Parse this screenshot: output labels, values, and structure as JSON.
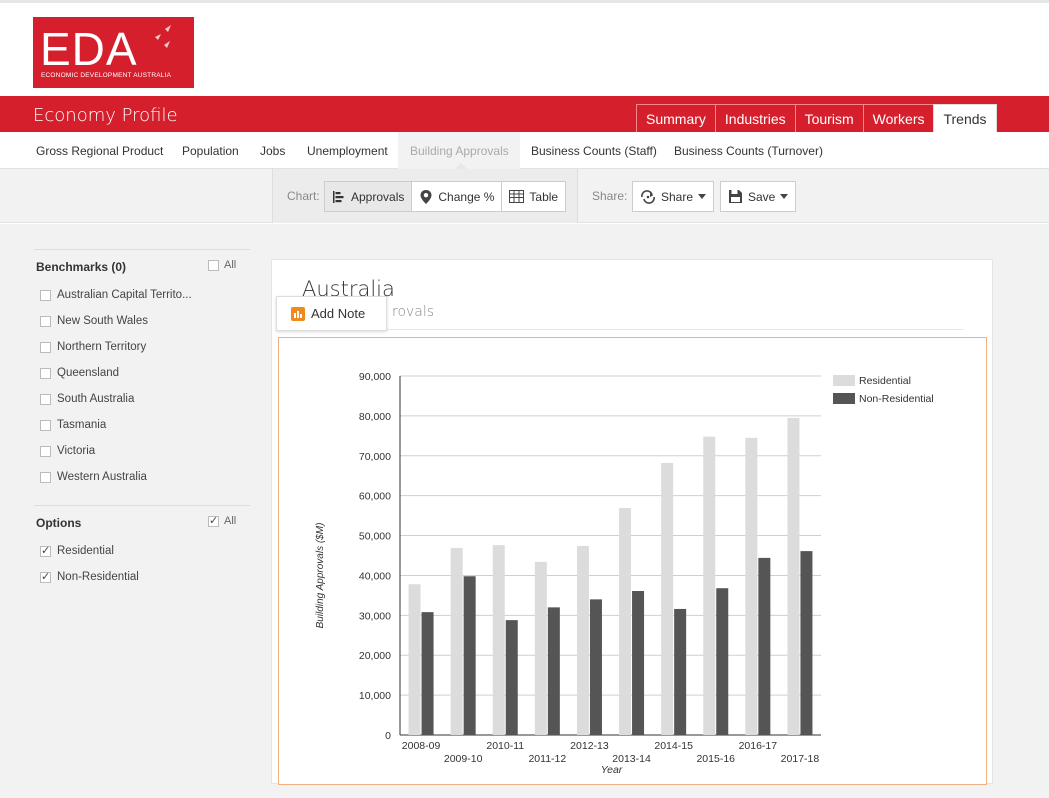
{
  "logo": {
    "text": "EDA",
    "subtitle": "ECONOMIC DEVELOPMENT AUSTRALIA"
  },
  "header": {
    "app_title": "Economy Profile",
    "tabs": [
      {
        "label": "Summary",
        "active": false
      },
      {
        "label": "Industries",
        "active": false
      },
      {
        "label": "Tourism",
        "active": false
      },
      {
        "label": "Workers",
        "active": false
      },
      {
        "label": "Trends",
        "active": true
      }
    ]
  },
  "subnav": {
    "items": [
      {
        "label": "Gross Regional Product"
      },
      {
        "label": "Population"
      },
      {
        "label": "Jobs"
      },
      {
        "label": "Unemployment"
      },
      {
        "label": "Building Approvals",
        "active": true
      },
      {
        "label": "Business Counts (Staff)"
      },
      {
        "label": "Business Counts (Turnover)"
      }
    ]
  },
  "toolbar": {
    "chart_label": "Chart:",
    "chart_buttons": [
      {
        "label": "Approvals",
        "icon": "bar-chart-icon",
        "active": true
      },
      {
        "label": "Change %",
        "icon": "map-pin-icon",
        "active": false
      },
      {
        "label": "Table",
        "icon": "table-icon",
        "active": false
      }
    ],
    "share_label": "Share:",
    "share_button": "Share",
    "save_button": "Save"
  },
  "sidebar": {
    "benchmarks_heading": "Benchmarks (0)",
    "benchmarks_all": "All",
    "benchmarks": [
      {
        "label": "Australian Capital Territo...",
        "checked": false
      },
      {
        "label": "New South Wales",
        "checked": false
      },
      {
        "label": "Northern Territory",
        "checked": false
      },
      {
        "label": "Queensland",
        "checked": false
      },
      {
        "label": "South Australia",
        "checked": false
      },
      {
        "label": "Tasmania",
        "checked": false
      },
      {
        "label": "Victoria",
        "checked": false
      },
      {
        "label": "Western Australia",
        "checked": false
      }
    ],
    "options_heading": "Options",
    "options_all": "All",
    "options": [
      {
        "label": "Residential",
        "checked": true
      },
      {
        "label": "Non-Residential",
        "checked": true
      }
    ]
  },
  "card": {
    "title": "Australia",
    "subtitle": "rovals",
    "add_note": "Add Note"
  },
  "chart_data": {
    "type": "bar",
    "categories": [
      "2008-09",
      "2009-10",
      "2010-11",
      "2011-12",
      "2012-13",
      "2013-14",
      "2014-15",
      "2015-16",
      "2016-17",
      "2017-18"
    ],
    "series": [
      {
        "name": "Residential",
        "color": "#dcdcdc",
        "values": [
          37800,
          46900,
          47600,
          43400,
          47400,
          56900,
          68200,
          74800,
          74500,
          79500
        ]
      },
      {
        "name": "Non-Residential",
        "color": "#555555",
        "values": [
          30800,
          39800,
          28800,
          32000,
          34000,
          36100,
          31600,
          36800,
          44400,
          46100
        ]
      }
    ],
    "xlabel": "Year",
    "ylabel": "Building Approvals ($M)",
    "ylim": [
      0,
      90000
    ],
    "yticks": [
      "0",
      "10,000",
      "20,000",
      "30,000",
      "40,000",
      "50,000",
      "60,000",
      "70,000",
      "80,000",
      "90,000"
    ],
    "grid": true,
    "legend": "top-right"
  }
}
